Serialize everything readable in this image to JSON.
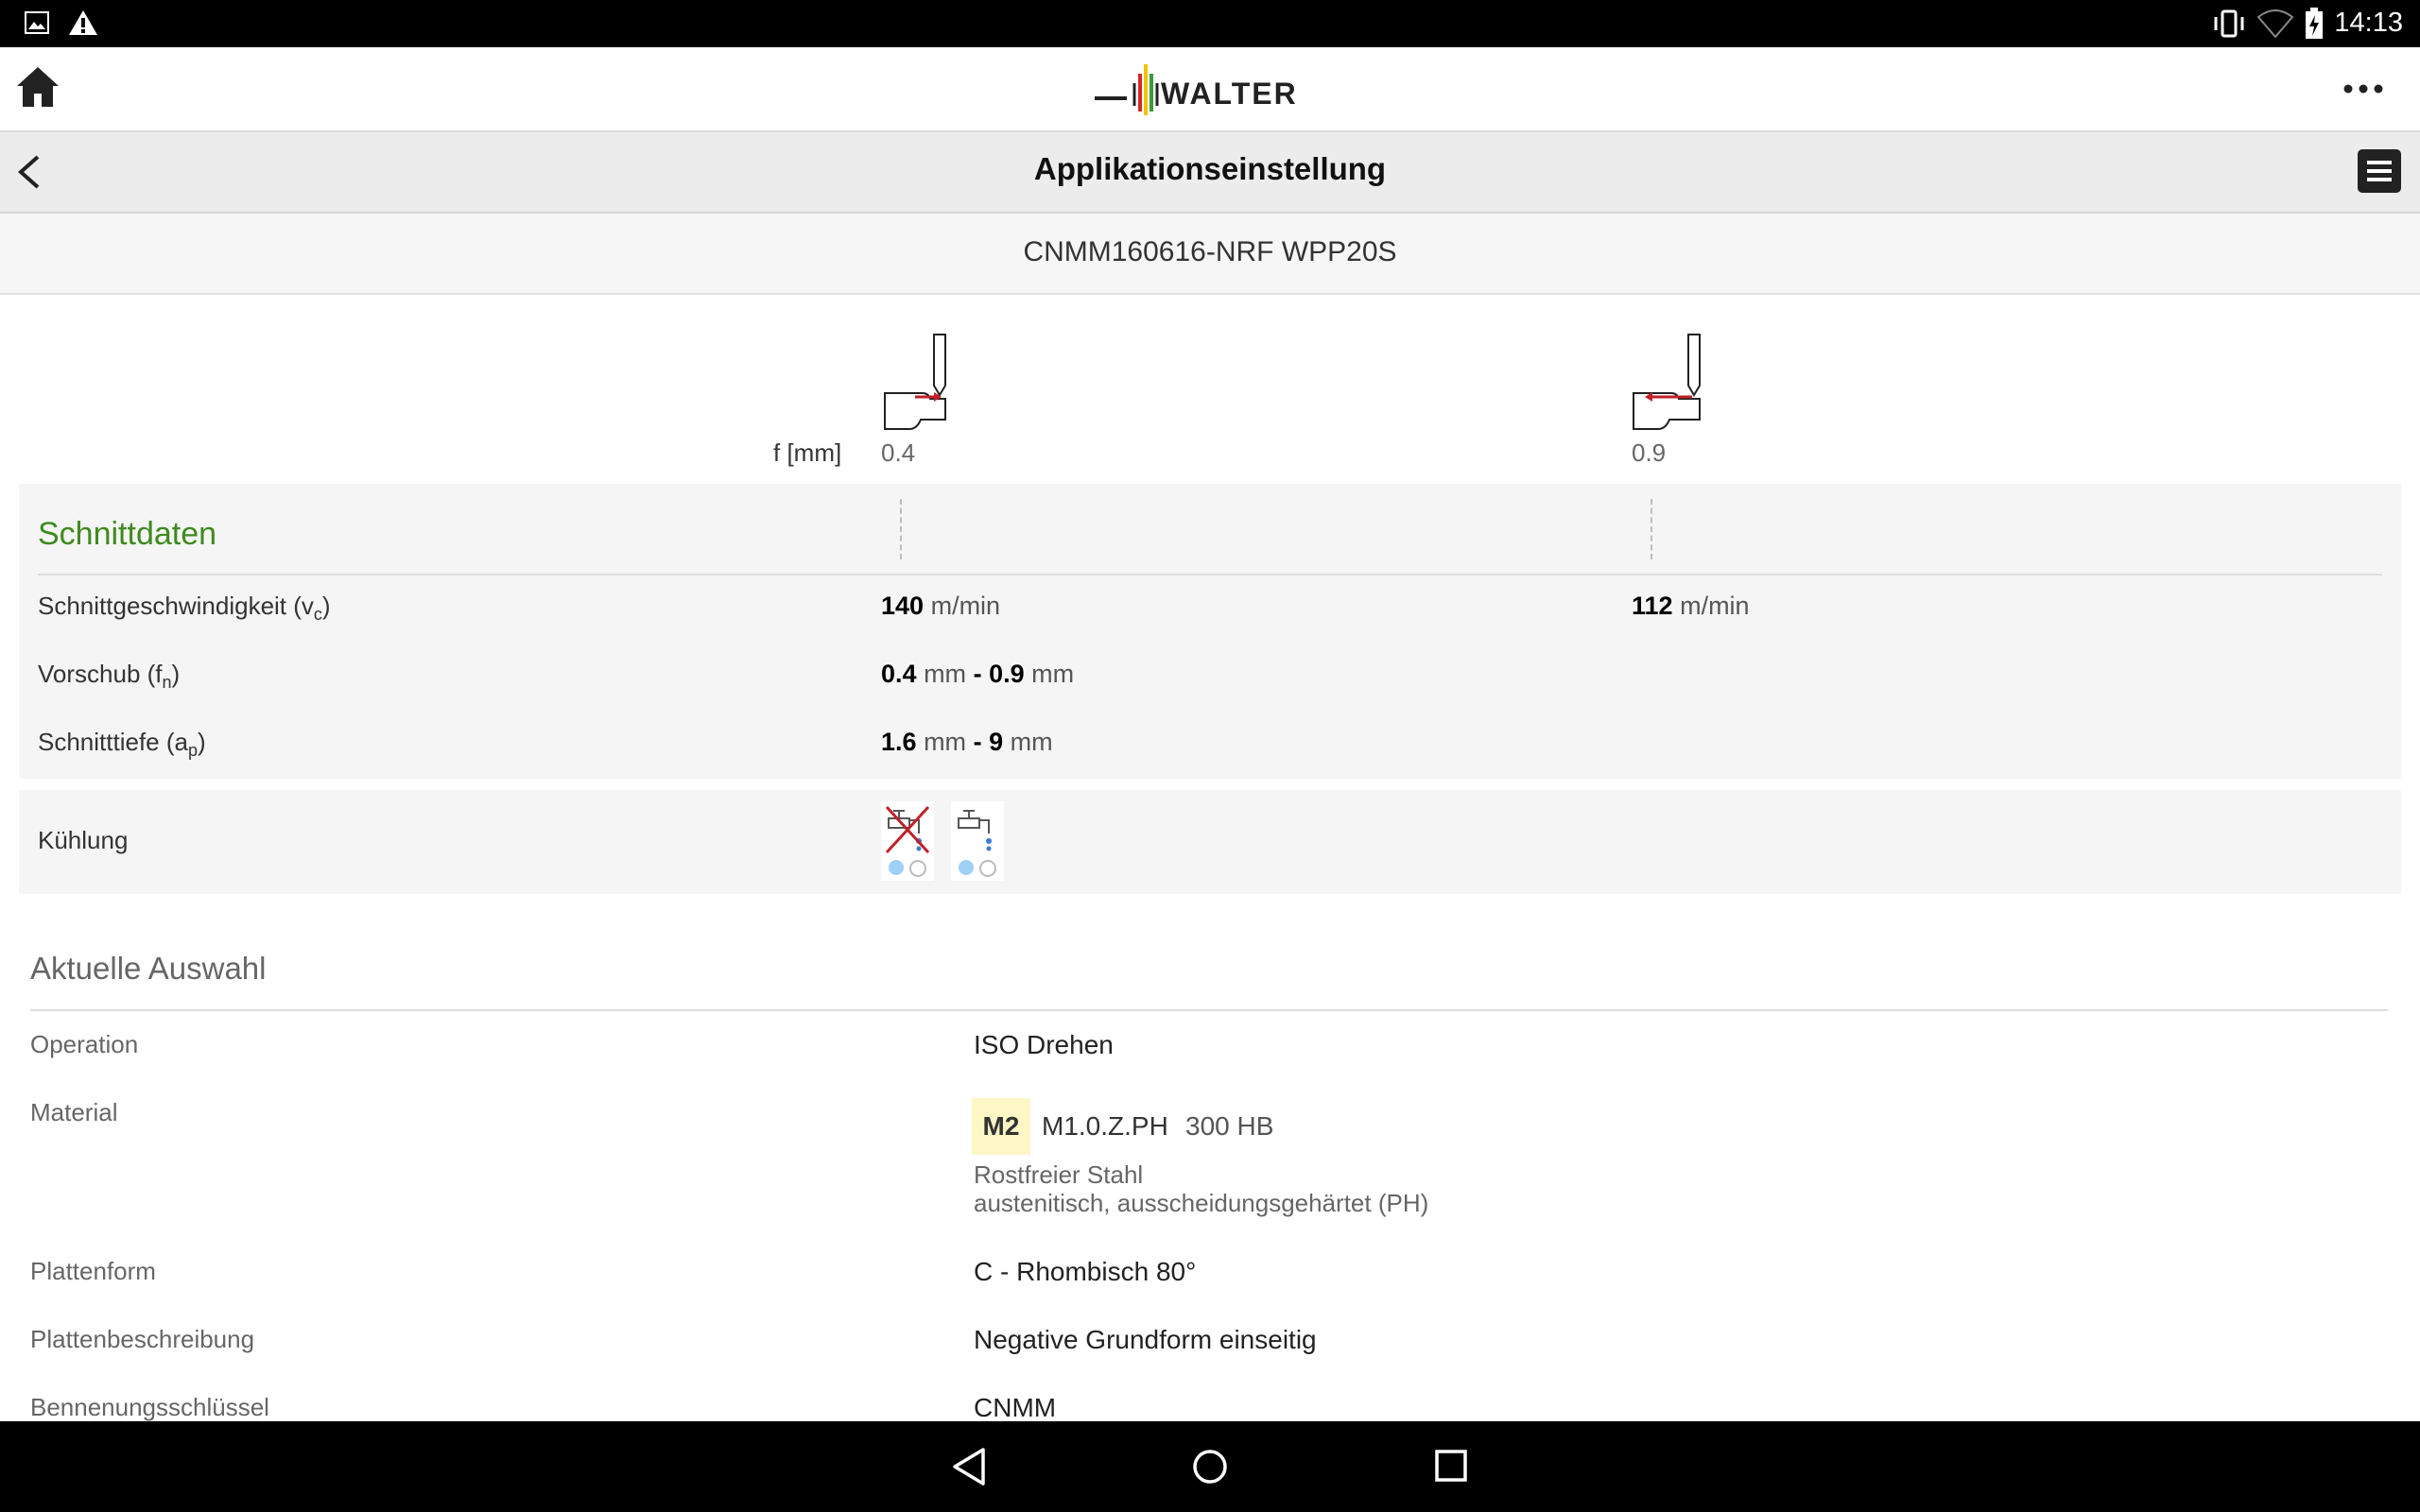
{
  "status_bar": {
    "time": "14:13",
    "left_icons": [
      "image-icon",
      "warning-icon"
    ],
    "right_icons": [
      "vibrate-icon",
      "wifi-icon",
      "battery-icon"
    ]
  },
  "app_bar": {
    "brand": "WALTER",
    "home_icon": "home-icon",
    "overflow_icon": "more-icon"
  },
  "title_bar": {
    "title": "Applikationseinstellung",
    "back_icon": "chevron-left-icon",
    "menu_icon": "list-icon"
  },
  "product": {
    "name": "CNMM160616-NRF WPP20S"
  },
  "feed_header": {
    "label": "f [mm]",
    "col1": "0.4",
    "col2": "0.9"
  },
  "cutting_data": {
    "section_title": "Schnittdaten",
    "rows": [
      {
        "label_main": "Schnittgeschwindigkeit (v",
        "label_sub": "c",
        "label_end": ")",
        "col1_value": "140",
        "col1_unit": "m/min",
        "col2_value": "112",
        "col2_unit": "m/min"
      },
      {
        "label_main": "Vorschub (f",
        "label_sub": "n",
        "label_end": ")",
        "from_value": "0.4",
        "from_unit": "mm",
        "sep": "-",
        "to_value": "0.9",
        "to_unit": "mm"
      },
      {
        "label_main": "Schnitttiefe (a",
        "label_sub": "p",
        "label_end": ")",
        "from_value": "1.6",
        "from_unit": "mm",
        "sep": "-",
        "to_value": "9",
        "to_unit": "mm"
      }
    ]
  },
  "cooling": {
    "label": "Kühlung",
    "options": [
      {
        "icon": "no-coolant-icon",
        "selected_dot": 1
      },
      {
        "icon": "coolant-tap-icon",
        "selected_dot": 1
      }
    ]
  },
  "current_selection": {
    "title": "Aktuelle Auswahl",
    "operation_label": "Operation",
    "operation_value": "ISO Drehen",
    "material_label": "Material",
    "material_badge": "M2",
    "material_code": "M1.0.Z.PH",
    "material_hardness": "300 HB",
    "material_desc1": "Rostfreier Stahl",
    "material_desc2": "austenitisch, ausscheidungsgehärtet (PH)",
    "plate_form_label": "Plattenform",
    "plate_form_value": "C - Rhombisch 80°",
    "plate_desc_label": "Plattenbeschreibung",
    "plate_desc_value": "Negative Grundform einseitig",
    "key_label": "Bennenungsschlüssel",
    "key_value": "CNMM"
  },
  "colors": {
    "section_green": "#3f8a1e",
    "badge_bg": "#fdf7c6",
    "dot_blue": "#9fd0f5",
    "arrow_red": "#c0212a",
    "logo_red": "#d12a2a",
    "logo_yellow": "#f3c300",
    "logo_green": "#3b9a3b"
  },
  "nav_bar": {
    "back_icon": "nav-back-icon",
    "home_icon": "nav-home-icon",
    "recents_icon": "nav-recents-icon"
  }
}
